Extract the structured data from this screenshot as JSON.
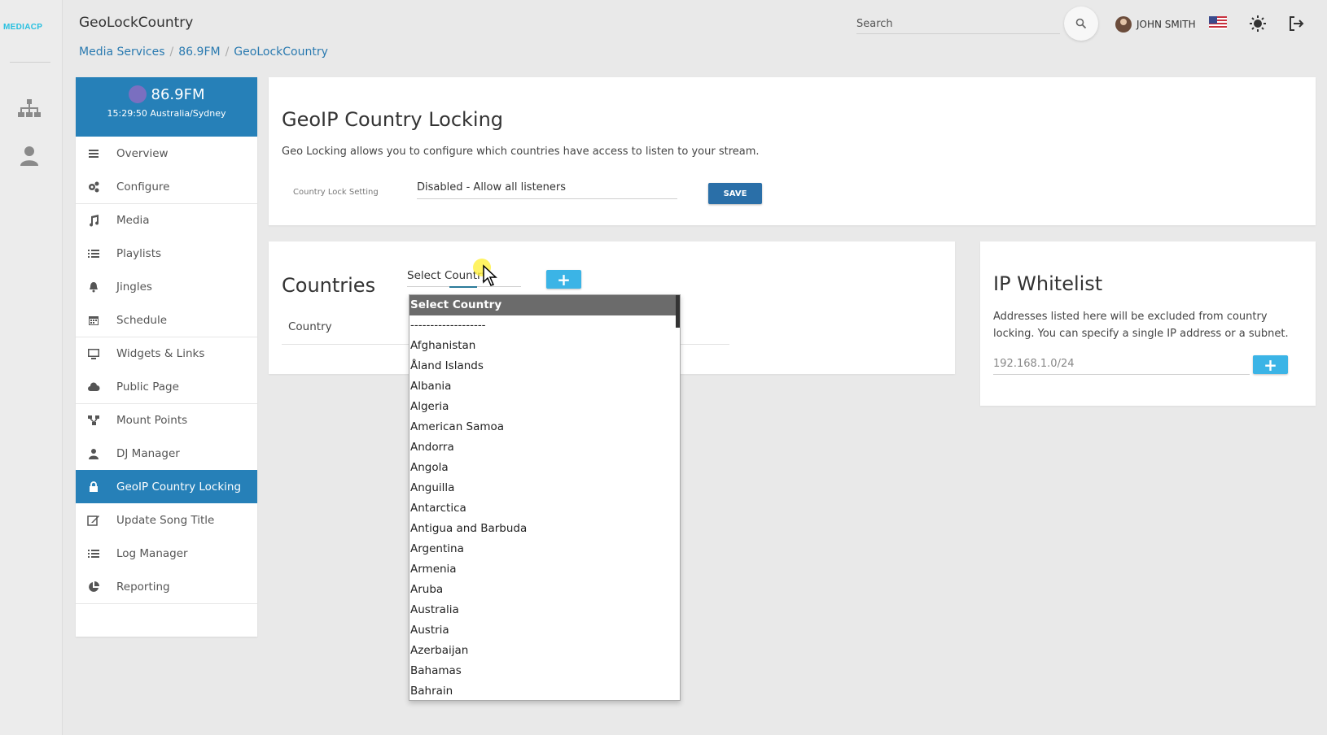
{
  "rail": {
    "logo": "MEDIACP",
    "icons": [
      "sitemap-icon",
      "user-icon"
    ]
  },
  "header": {
    "title": "GeoLockCountry",
    "breadcrumb": [
      "Media Services",
      "86.9FM",
      "GeoLockCountry"
    ],
    "search_placeholder": "Search",
    "user_name": "JOHN SMITH",
    "icons": [
      "search-icon",
      "flag-us-icon",
      "brightness-icon",
      "logout-icon"
    ]
  },
  "sidebar": {
    "station_name": "86.9FM",
    "station_time": "15:29:50 Australia/Sydney",
    "items": [
      {
        "label": "Overview",
        "icon": "bars-icon"
      },
      {
        "label": "Configure",
        "icon": "cogs-icon"
      },
      {
        "label": "Media",
        "icon": "music-icon"
      },
      {
        "label": "Playlists",
        "icon": "list-icon"
      },
      {
        "label": "Jingles",
        "icon": "bell-icon"
      },
      {
        "label": "Schedule",
        "icon": "calendar-icon"
      },
      {
        "label": "Widgets & Links",
        "icon": "monitor-icon"
      },
      {
        "label": "Public Page",
        "icon": "cloud-icon"
      },
      {
        "label": "Mount Points",
        "icon": "sitemap-icon"
      },
      {
        "label": "DJ Manager",
        "icon": "user-icon"
      },
      {
        "label": "GeoIP Country Locking",
        "icon": "lock-icon"
      },
      {
        "label": "Update Song Title",
        "icon": "edit-icon"
      },
      {
        "label": "Log Manager",
        "icon": "list-icon"
      },
      {
        "label": "Reporting",
        "icon": "pie-chart-icon"
      }
    ],
    "active_item": "GeoIP Country Locking"
  },
  "geo": {
    "title": "GeoIP Country Locking",
    "description": "Geo Locking allows you to configure which countries have access to listen to your stream.",
    "setting_label": "Country Lock Setting",
    "setting_value": "Disabled - Allow all listeners",
    "save_label": "SAVE"
  },
  "countries": {
    "title": "Countries",
    "select_value": "Select Country",
    "add_label": "+",
    "column_header": "Country"
  },
  "ip_whitelist": {
    "title": "IP Whitelist",
    "description": "Addresses listed here will be excluded from country locking. You can specify a single IP address or a subnet.",
    "input_placeholder": "192.168.1.0/24",
    "add_label": "+"
  },
  "dropdown": {
    "options": [
      "Select Country",
      "-------------------",
      "Afghanistan",
      "Åland Islands",
      "Albania",
      "Algeria",
      "American Samoa",
      "Andorra",
      "Angola",
      "Anguilla",
      "Antarctica",
      "Antigua and Barbuda",
      "Argentina",
      "Armenia",
      "Aruba",
      "Australia",
      "Austria",
      "Azerbaijan",
      "Bahamas",
      "Bahrain"
    ],
    "selected": "Select Country"
  },
  "colors": {
    "accent": "#2680b8",
    "add_button": "#3bb4e6",
    "save_button": "#2a6fa8",
    "logo": "#27c0e0"
  }
}
